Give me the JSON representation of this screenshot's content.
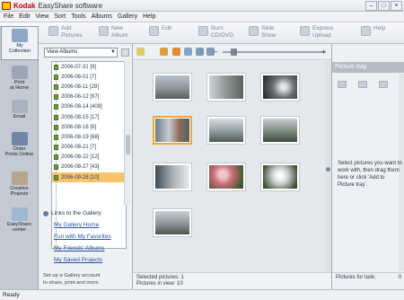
{
  "app": {
    "brand": "Kodak",
    "title": "EasyShare software"
  },
  "window_controls": {
    "minimize": "–",
    "maximize": "□",
    "close": "×"
  },
  "menu": [
    "File",
    "Edit",
    "View",
    "Sort",
    "Tools",
    "Albums",
    "Gallery",
    "Help"
  ],
  "toolbar": {
    "add_pictures": "Add\nPictures",
    "new_album": "New\nAlbum",
    "edit": "Edit",
    "burn": "Burn\nCD/DVD",
    "slide_show": "Slide\nShow",
    "express_upload": "Express\nUpload",
    "help": "Help"
  },
  "nav": {
    "my_collection": "My\nCollection",
    "print_at_home": "Print\nat Home",
    "email": "Email",
    "order_prints": "Order\nPrints Online",
    "creative_projects": "Creative\nProjects",
    "easyshare_center": "EasyShare\ncenter"
  },
  "panel": {
    "view_select": "View Albums",
    "albums": [
      "2006-07-31 [9]",
      "2006-08-01 [7]",
      "2006-08-11 [29]",
      "2006-08-12 [97]",
      "2006-08-14 [408]",
      "2006-08-15 [17]",
      "2006-08-16 [8]",
      "2006-08-19 [68]",
      "2006-08-21 [7]",
      "2006-08-22 [12]",
      "2006-08-27 [43]",
      "2006-09-28 [10]"
    ],
    "selected_album_index": 11
  },
  "links": {
    "header": "Links to the Gallery",
    "items": [
      "My Gallery Home",
      "Fun with My Favorites",
      "My Friends' Albums",
      "My Saved Projects"
    ]
  },
  "gallery_msg": "Set up a Gallery account\nto share, print and more.",
  "work_status": {
    "selected": "Selected pictures: 1",
    "in_view": "Pictures in view: 10"
  },
  "zoom": {
    "minus": "–",
    "plus": "+",
    "level": 0.08
  },
  "tray": {
    "header": "Picture tray",
    "message": "Select pictures you want to work with, then drag them here or click 'Add to Picture tray'.",
    "pictures_for_task_label": "Pictures for task:",
    "pictures_for_task_count": "0"
  },
  "statusbar": "Ready",
  "thumbnails": [
    {
      "name": "thumb-1"
    },
    {
      "name": "thumb-2"
    },
    {
      "name": "thumb-3"
    },
    {
      "name": "thumb-4"
    },
    {
      "name": "thumb-5"
    },
    {
      "name": "thumb-6"
    },
    {
      "name": "thumb-7"
    },
    {
      "name": "thumb-8"
    },
    {
      "name": "thumb-9"
    },
    {
      "name": "thumb-10"
    }
  ],
  "colors": {
    "accent_selected": "#f3a82e",
    "brand_red": "#cc0000",
    "link_blue": "#2b4ea3"
  }
}
